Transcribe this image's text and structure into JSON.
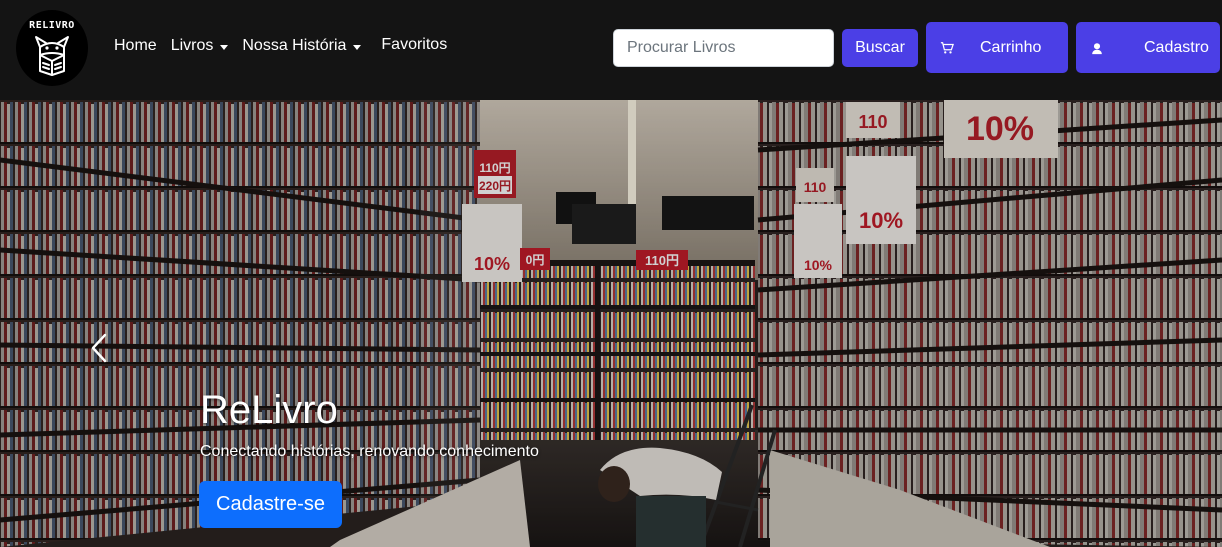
{
  "brand": {
    "logo_text": "RELIVRO",
    "accent": "#4b3fe6"
  },
  "nav": {
    "home": "Home",
    "livros": "Livros",
    "historia": "Nossa História",
    "favoritos": "Favoritos"
  },
  "search": {
    "placeholder": "Procurar Livros",
    "value": "",
    "button": "Buscar"
  },
  "actions": {
    "cart": {
      "label": "Carrinho",
      "icon": "cart-icon"
    },
    "signup": {
      "label": "Cadastro",
      "icon": "user-icon"
    }
  },
  "hero": {
    "title": "ReLivro",
    "subtitle": "Conectando histórias, renovando conhecimento",
    "cta": "Cadastre-se",
    "cta_color": "#0d6efd",
    "prev_icon": "chevron-left-icon",
    "signs": {
      "s1": "110円",
      "s2": "220円",
      "s3": "10%",
      "s4": "110",
      "s5": "10%",
      "s6": "110円",
      "s7": "10%",
      "s8": "10%",
      "s9": "110",
      "s10": "0円"
    }
  }
}
